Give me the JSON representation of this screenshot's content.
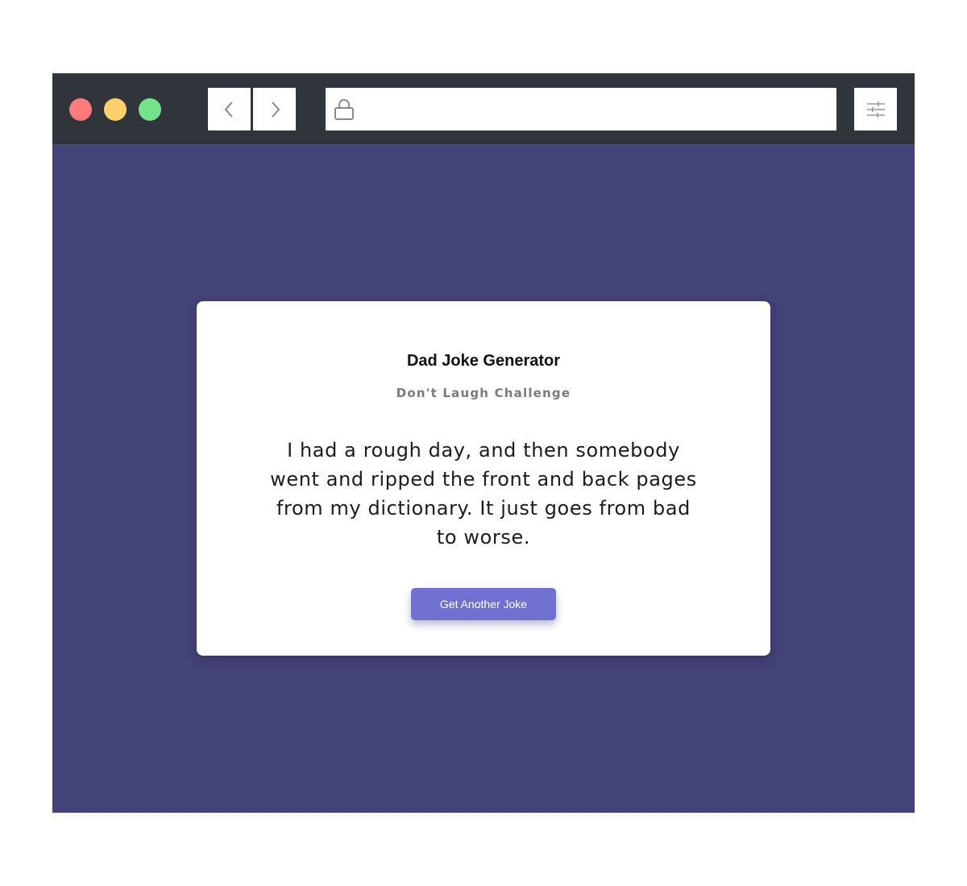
{
  "browser": {
    "url": "",
    "colors": {
      "titlebar": "#2f353b",
      "close": "#ff7b7b",
      "minimize": "#ffcf6a",
      "maximize": "#74e48a",
      "page_background": "#434279"
    },
    "icons": [
      "back-arrow-icon",
      "forward-arrow-icon",
      "lock-icon",
      "sliders-icon"
    ]
  },
  "card": {
    "title": "Dad Joke Generator",
    "subtitle": "Don't Laugh Challenge",
    "joke": "I had a rough day, and then somebody went and ripped the front and back pages from my dictionary. It just goes from bad to worse.",
    "button_label": "Get Another Joke",
    "button_color": "#7070d1"
  }
}
